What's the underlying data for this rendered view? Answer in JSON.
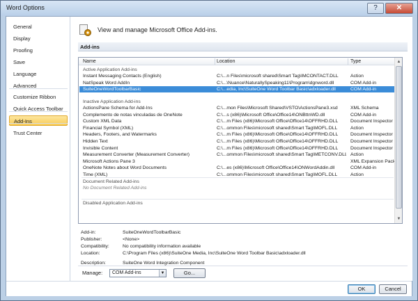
{
  "window": {
    "title": "Word Options",
    "help_label": "?",
    "close_label": "✕"
  },
  "sidebar": {
    "items": [
      {
        "label": "General"
      },
      {
        "label": "Display"
      },
      {
        "label": "Proofing"
      },
      {
        "label": "Save"
      },
      {
        "label": "Language"
      },
      {
        "label": "Advanced"
      },
      {
        "label": "Customize Ribbon"
      },
      {
        "label": "Quick Access Toolbar"
      },
      {
        "label": "Add-Ins"
      },
      {
        "label": "Trust Center"
      }
    ],
    "active": "Add-Ins"
  },
  "header": {
    "text": "View and manage Microsoft Office Add-ins."
  },
  "section": {
    "title": "Add-ins"
  },
  "list": {
    "columns": {
      "name": "Name",
      "location": "Location",
      "type": "Type"
    },
    "groups": {
      "active": "Active Application Add-ins",
      "inactive": "Inactive Application Add-ins",
      "document": "Document Related Add-ins",
      "document_empty": "No Document Related Add-ins",
      "disabled": "Disabled Application Add-ins"
    },
    "active_rows": [
      {
        "name": "Instant Messaging Contacts (English)",
        "location": "C:\\...n Files\\microsoft shared\\Smart Tag\\IMCONTACT.DLL",
        "type": "Action"
      },
      {
        "name": "NatSpeak Word AddIn",
        "location": "C:\\...\\Nuance\\NaturallySpeaking11\\Program\\dgnword.dll",
        "type": "COM Add-in"
      },
      {
        "name": "SuiteOneWordToolbarBasic",
        "location": "C:\\...edia, Inc\\SuiteOne Word Toolbar Basic\\adxloader.dll",
        "type": "COM Add-in"
      }
    ],
    "inactive_rows": [
      {
        "name": "ActionsPane Schema for Add-Ins",
        "location": "C:\\...mon Files\\Microsoft Shared\\VSTO\\ActionsPane3.xsd",
        "type": "XML Schema"
      },
      {
        "name": "Complemento de notas vinculadas de OneNote",
        "location": "C:\\...s (x86)\\Microsoft Office\\Office14\\ONBttnWD.dll",
        "type": "COM Add-in"
      },
      {
        "name": "Custom XML Data",
        "location": "C:\\...m Files (x86)\\Microsoft Office\\Office14\\OFFRHD.DLL",
        "type": "Document Inspector"
      },
      {
        "name": "Financial Symbol (XML)",
        "location": "C:\\...ommon Files\\microsoft shared\\Smart Tag\\MOFL.DLL",
        "type": "Action"
      },
      {
        "name": "Headers, Footers, and Watermarks",
        "location": "C:\\...m Files (x86)\\Microsoft Office\\Office14\\OFFRHD.DLL",
        "type": "Document Inspector"
      },
      {
        "name": "Hidden Text",
        "location": "C:\\...m Files (x86)\\Microsoft Office\\Office14\\OFFRHD.DLL",
        "type": "Document Inspector"
      },
      {
        "name": "Invisible Content",
        "location": "C:\\...m Files (x86)\\Microsoft Office\\Office14\\OFFRHD.DLL",
        "type": "Document Inspector"
      },
      {
        "name": "Measurement Converter (Measurement Converter)",
        "location": "C:\\...ommon Files\\microsoft shared\\Smart Tag\\METCONV.DLL",
        "type": "Action"
      },
      {
        "name": "Microsoft Actions Pane 3",
        "location": "",
        "type": "XML Expansion Pack"
      },
      {
        "name": "OneNote Notes about Word Documents",
        "location": "C:\\...es (x86)\\Microsoft Office\\Office14\\ONWordAddin.dll",
        "type": "COM Add-in"
      },
      {
        "name": "Time (XML)",
        "location": "C:\\...ommon Files\\microsoft shared\\Smart Tag\\MOFL.DLL",
        "type": "Action"
      }
    ],
    "selected_row": "SuiteOneWordToolbarBasic"
  },
  "details": {
    "addin": {
      "label": "Add-in:",
      "value": "SuiteOneWordToolbarBasic"
    },
    "publisher": {
      "label": "Publisher:",
      "value": "<None>"
    },
    "compatibility": {
      "label": "Compatibility:",
      "value": "No compatibility information available"
    },
    "location": {
      "label": "Location:",
      "value": "C:\\Program Files (x86)\\SuiteOne Media, Inc\\SuiteOne Word Toolbar Basic\\adxloader.dll"
    },
    "description": {
      "label": "Description:",
      "value": "SuiteOne Word Integration Component"
    }
  },
  "manage": {
    "label": "Manage:",
    "selected": "COM Add-ins",
    "go_label": "Go..."
  },
  "footer": {
    "ok_label": "OK",
    "cancel_label": "Cancel"
  },
  "colors": {
    "selection": "#3b8cd8",
    "active_nav": "#f8cc55",
    "frame": "#bcd0e6"
  }
}
